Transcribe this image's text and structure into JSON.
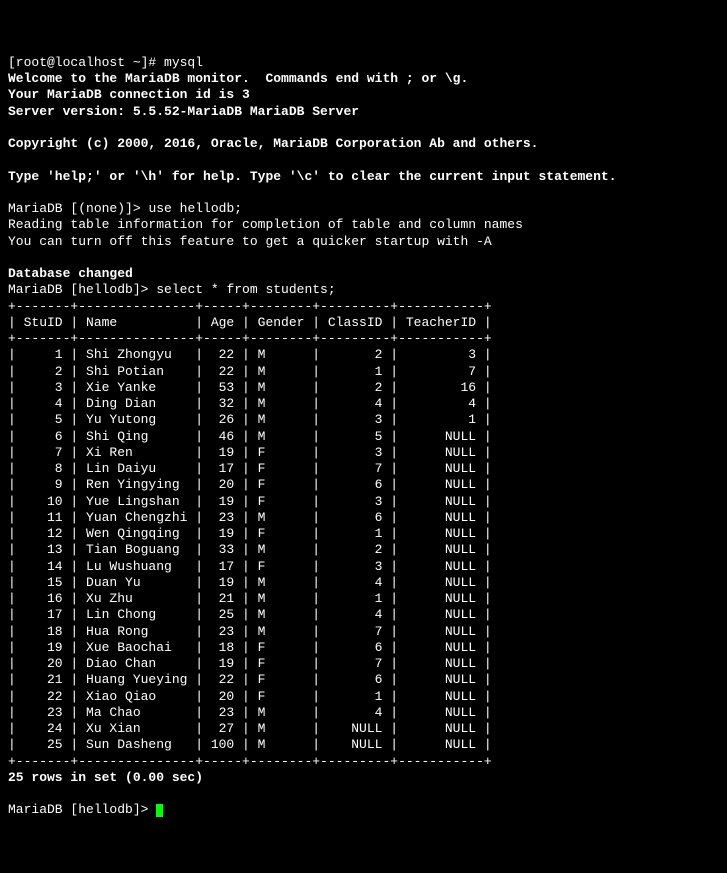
{
  "prompt_root": "[root@localhost ~]# ",
  "cmd_mysql": "mysql",
  "welcome": {
    "l1": "Welcome to the MariaDB monitor.  Commands end with ; or \\g.",
    "l2": "Your MariaDB connection id is 3",
    "l3": "Server version: 5.5.52-MariaDB MariaDB Server",
    "copyright": "Copyright (c) 2000, 2016, Oracle, MariaDB Corporation Ab and others.",
    "help": "Type 'help;' or '\\h' for help. Type '\\c' to clear the current input statement."
  },
  "prompt_none": "MariaDB [(none)]> ",
  "cmd_use": "use hellodb;",
  "use_msg1": "Reading table information for completion of table and column names",
  "use_msg2": "You can turn off this feature to get a quicker startup with -A",
  "db_changed": "Database changed",
  "prompt_hello": "MariaDB [hellodb]> ",
  "cmd_select": "select * from students;",
  "table": {
    "sep": "+-------+---------------+-----+--------+---------+-----------+",
    "head": "| StuID | Name          | Age | Gender | ClassID | TeacherID |",
    "rows": [
      "|     1 | Shi Zhongyu   |  22 | M      |       2 |         3 |",
      "|     2 | Shi Potian    |  22 | M      |       1 |         7 |",
      "|     3 | Xie Yanke     |  53 | M      |       2 |        16 |",
      "|     4 | Ding Dian     |  32 | M      |       4 |         4 |",
      "|     5 | Yu Yutong     |  26 | M      |       3 |         1 |",
      "|     6 | Shi Qing      |  46 | M      |       5 |      NULL |",
      "|     7 | Xi Ren        |  19 | F      |       3 |      NULL |",
      "|     8 | Lin Daiyu     |  17 | F      |       7 |      NULL |",
      "|     9 | Ren Yingying  |  20 | F      |       6 |      NULL |",
      "|    10 | Yue Lingshan  |  19 | F      |       3 |      NULL |",
      "|    11 | Yuan Chengzhi |  23 | M      |       6 |      NULL |",
      "|    12 | Wen Qingqing  |  19 | F      |       1 |      NULL |",
      "|    13 | Tian Boguang  |  33 | M      |       2 |      NULL |",
      "|    14 | Lu Wushuang   |  17 | F      |       3 |      NULL |",
      "|    15 | Duan Yu       |  19 | M      |       4 |      NULL |",
      "|    16 | Xu Zhu        |  21 | M      |       1 |      NULL |",
      "|    17 | Lin Chong     |  25 | M      |       4 |      NULL |",
      "|    18 | Hua Rong      |  23 | M      |       7 |      NULL |",
      "|    19 | Xue Baochai   |  18 | F      |       6 |      NULL |",
      "|    20 | Diao Chan     |  19 | F      |       7 |      NULL |",
      "|    21 | Huang Yueying |  22 | F      |       6 |      NULL |",
      "|    22 | Xiao Qiao     |  20 | F      |       1 |      NULL |",
      "|    23 | Ma Chao       |  23 | M      |       4 |      NULL |",
      "|    24 | Xu Xian       |  27 | M      |    NULL |      NULL |",
      "|    25 | Sun Dasheng   | 100 | M      |    NULL |      NULL |"
    ],
    "footer": "25 rows in set (0.00 sec)"
  },
  "chart_data": {
    "type": "table",
    "columns": [
      "StuID",
      "Name",
      "Age",
      "Gender",
      "ClassID",
      "TeacherID"
    ],
    "rows": [
      [
        1,
        "Shi Zhongyu",
        22,
        "M",
        2,
        3
      ],
      [
        2,
        "Shi Potian",
        22,
        "M",
        1,
        7
      ],
      [
        3,
        "Xie Yanke",
        53,
        "M",
        2,
        16
      ],
      [
        4,
        "Ding Dian",
        32,
        "M",
        4,
        4
      ],
      [
        5,
        "Yu Yutong",
        26,
        "M",
        3,
        1
      ],
      [
        6,
        "Shi Qing",
        46,
        "M",
        5,
        null
      ],
      [
        7,
        "Xi Ren",
        19,
        "F",
        3,
        null
      ],
      [
        8,
        "Lin Daiyu",
        17,
        "F",
        7,
        null
      ],
      [
        9,
        "Ren Yingying",
        20,
        "F",
        6,
        null
      ],
      [
        10,
        "Yue Lingshan",
        19,
        "F",
        3,
        null
      ],
      [
        11,
        "Yuan Chengzhi",
        23,
        "M",
        6,
        null
      ],
      [
        12,
        "Wen Qingqing",
        19,
        "F",
        1,
        null
      ],
      [
        13,
        "Tian Boguang",
        33,
        "M",
        2,
        null
      ],
      [
        14,
        "Lu Wushuang",
        17,
        "F",
        3,
        null
      ],
      [
        15,
        "Duan Yu",
        19,
        "M",
        4,
        null
      ],
      [
        16,
        "Xu Zhu",
        21,
        "M",
        1,
        null
      ],
      [
        17,
        "Lin Chong",
        25,
        "M",
        4,
        null
      ],
      [
        18,
        "Hua Rong",
        23,
        "M",
        7,
        null
      ],
      [
        19,
        "Xue Baochai",
        18,
        "F",
        6,
        null
      ],
      [
        20,
        "Diao Chan",
        19,
        "F",
        7,
        null
      ],
      [
        21,
        "Huang Yueying",
        22,
        "F",
        6,
        null
      ],
      [
        22,
        "Xiao Qiao",
        20,
        "F",
        1,
        null
      ],
      [
        23,
        "Ma Chao",
        23,
        "M",
        4,
        null
      ],
      [
        24,
        "Xu Xian",
        27,
        "M",
        null,
        null
      ],
      [
        25,
        "Sun Dasheng",
        100,
        "M",
        null,
        null
      ]
    ]
  }
}
